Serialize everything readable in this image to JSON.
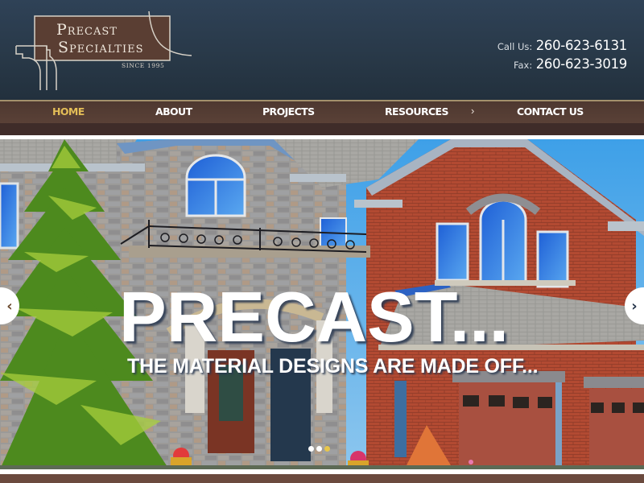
{
  "brand": {
    "name_line1": "Precast",
    "name_line2": "Specialties",
    "since": "SINCE 1995",
    "logo_panel_color": "#5a3e33"
  },
  "contact": {
    "call_label": "Call Us:",
    "call_number": "260-623-6131",
    "fax_label": "Fax:",
    "fax_number": "260-623-3019"
  },
  "nav": {
    "items": [
      {
        "label": "HOME",
        "active": true
      },
      {
        "label": "ABOUT",
        "active": false
      },
      {
        "label": "PROJECTS",
        "active": false
      },
      {
        "label": "RESOURCES",
        "active": false
      },
      {
        "label": "CONTACT US",
        "active": false
      }
    ],
    "submenu_indicator": "›",
    "active_color": "#e3bd57",
    "bar_color": "#5a4137"
  },
  "hero": {
    "title": "PRECAST...",
    "subtitle": "THE MATERIAL DESIGNS ARE MADE OFF...",
    "prev_icon": "‹",
    "next_icon": "›",
    "slides_total": 3,
    "active_slide": 3,
    "dot_active_color": "#e8c64b"
  },
  "colors": {
    "header_bg": "#2b3c4e",
    "footer_bar": "#6b4a3e"
  }
}
